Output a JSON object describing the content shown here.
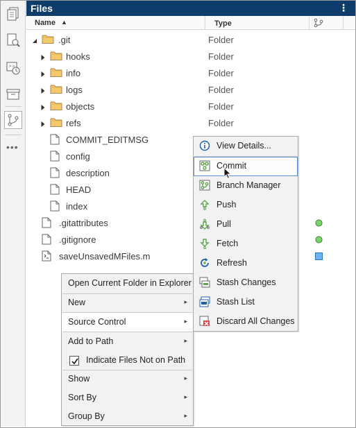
{
  "panel": {
    "title": "Files",
    "menu_glyph": "⋮"
  },
  "columns": {
    "name": "Name",
    "sort_indicator": "▲",
    "type": "Type",
    "source_control_icon": "git-branch-icon"
  },
  "toolstrip": {
    "items": [
      "files-icon",
      "find-files-icon",
      "history-icon",
      "archive-icon",
      "source-control-icon"
    ],
    "more": "•••"
  },
  "rows": [
    {
      "name": ".git",
      "type": "Folder",
      "kind": "folder",
      "expanded": true,
      "level": 0
    },
    {
      "name": "hooks",
      "type": "Folder",
      "kind": "folder",
      "expanded": false,
      "level": 1
    },
    {
      "name": "info",
      "type": "Folder",
      "kind": "folder",
      "expanded": false,
      "level": 1
    },
    {
      "name": "logs",
      "type": "Folder",
      "kind": "folder",
      "expanded": false,
      "level": 1
    },
    {
      "name": "objects",
      "type": "Folder",
      "kind": "folder",
      "expanded": false,
      "level": 1
    },
    {
      "name": "refs",
      "type": "Folder",
      "kind": "folder",
      "expanded": false,
      "level": 1
    },
    {
      "name": "COMMIT_EDITMSG",
      "type": "",
      "kind": "file",
      "level": 1
    },
    {
      "name": "config",
      "type": "",
      "kind": "file",
      "level": 1
    },
    {
      "name": "description",
      "type": "",
      "kind": "file",
      "level": 1
    },
    {
      "name": "HEAD",
      "type": "",
      "kind": "file",
      "level": 1
    },
    {
      "name": "index",
      "type": "",
      "kind": "file",
      "level": 1
    },
    {
      "name": ".gitattributes",
      "type": "",
      "kind": "file",
      "level": 0,
      "status": "unmodified"
    },
    {
      "name": ".gitignore",
      "type": "",
      "kind": "file",
      "level": 0,
      "status": "unmodified"
    },
    {
      "name": "saveUnsavedMFiles.m",
      "type": "",
      "kind": "mfile",
      "level": 0,
      "status": "not-under-control"
    }
  ],
  "status_colors": {
    "unmodified": "#7ad46a",
    "not-under-control": "#6bb4f0"
  },
  "context_menu": {
    "items": [
      {
        "label": "Open Current Folder in Explorer",
        "submenu": false
      },
      {
        "label": "New",
        "submenu": true
      },
      {
        "label": "Source Control",
        "submenu": true,
        "highlighted": true
      },
      {
        "label": "Add to Path",
        "submenu": true
      },
      {
        "label": "Indicate Files Not on Path",
        "checked": true
      },
      {
        "label": "Show",
        "submenu": true
      },
      {
        "label": "Sort By",
        "submenu": true
      },
      {
        "label": "Group By",
        "submenu": true
      }
    ],
    "submenu_glyph": "▸"
  },
  "source_control_menu": {
    "items": [
      {
        "label": "View Details...",
        "icon": "info-icon"
      },
      {
        "label": "Commit",
        "icon": "commit-icon",
        "highlighted": true
      },
      {
        "label": "Branch Manager",
        "icon": "branch-manager-icon"
      },
      {
        "label": "Push",
        "icon": "push-icon"
      },
      {
        "label": "Pull",
        "icon": "pull-icon"
      },
      {
        "label": "Fetch",
        "icon": "fetch-icon"
      },
      {
        "label": "Refresh",
        "icon": "refresh-icon"
      },
      {
        "label": "Stash Changes",
        "icon": "stash-changes-icon"
      },
      {
        "label": "Stash List",
        "icon": "stash-list-icon"
      },
      {
        "label": "Discard All Changes",
        "icon": "discard-changes-icon"
      }
    ]
  },
  "colors": {
    "titlebar": "#0e3c6b",
    "folder": "#f3c96b",
    "highlight_border": "#5b8fd6",
    "git_icon": "#5aa64a"
  }
}
